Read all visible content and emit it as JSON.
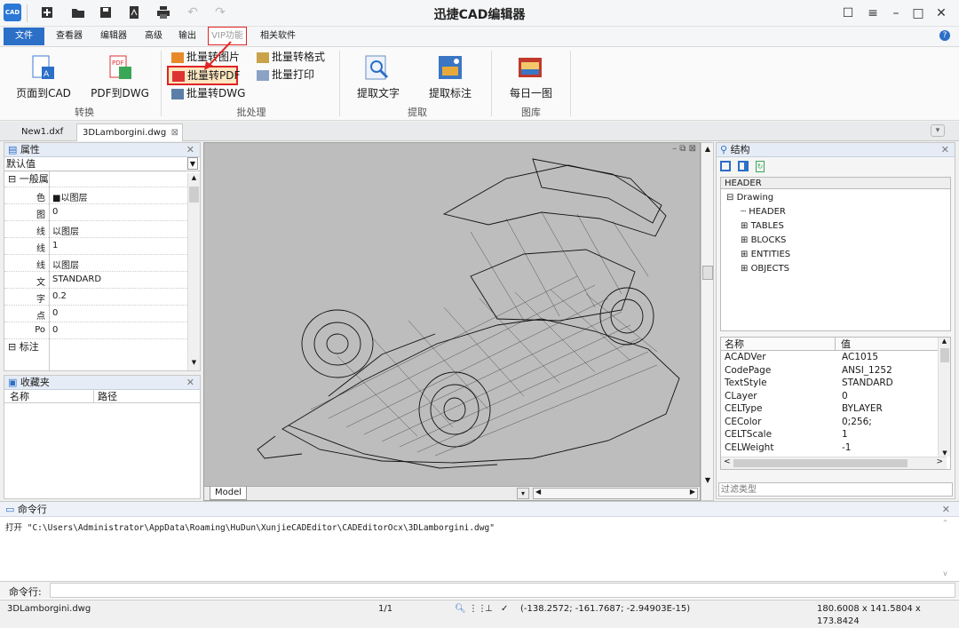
{
  "app": {
    "title": "迅捷CAD编辑器",
    "logo": "CAD"
  },
  "quick_access": {
    "icons": [
      "new-file-icon",
      "open-folder-icon",
      "save-icon",
      "pdf-icon",
      "print-icon",
      "undo-icon",
      "redo-icon"
    ]
  },
  "window_controls": {
    "icons": [
      "feedback-icon",
      "menu-icon",
      "minimize-icon",
      "close-icon"
    ]
  },
  "menu_tabs": [
    "文件",
    "查看器",
    "编辑器",
    "高级",
    "输出",
    "VIP功能",
    "相关软件"
  ],
  "ribbon": {
    "convert": {
      "page_to_cad": "页面到CAD",
      "pdf_to_dwg": "PDF到DWG",
      "group": "转换"
    },
    "batch": {
      "to_image": "批量转图片",
      "to_format": "批量转格式",
      "to_pdf": "批量转PDF",
      "print": "批量打印",
      "to_dwg": "批量转DWG",
      "group": "批处理"
    },
    "extract": {
      "text": "提取文字",
      "annotation": "提取标注",
      "group": "提取"
    },
    "gallery": {
      "daily": "每日一图",
      "group": "图库"
    }
  },
  "doc_tabs": [
    "New1.dxf",
    "3DLamborgini.dwg"
  ],
  "properties": {
    "title": "属性",
    "dropdown": "默认值",
    "section": "一般属",
    "rows": [
      {
        "k": "色",
        "v": "■以图层"
      },
      {
        "k": "图",
        "v": "0"
      },
      {
        "k": "线",
        "v": "以图层"
      },
      {
        "k": "线",
        "v": "1"
      },
      {
        "k": "线",
        "v": "以图层"
      },
      {
        "k": "文",
        "v": "STANDARD"
      },
      {
        "k": "字",
        "v": "0.2"
      },
      {
        "k": "点",
        "v": "0"
      },
      {
        "k": "Po",
        "v": "0"
      }
    ],
    "section2": "标注"
  },
  "favorites": {
    "title": "收藏夹",
    "col_name": "名称",
    "col_path": "路径"
  },
  "canvas": {
    "model_tab": "Model"
  },
  "structure": {
    "title": "结构",
    "header_field": "HEADER",
    "tree": {
      "root": "Drawing",
      "items": [
        "HEADER",
        "TABLES",
        "BLOCKS",
        "ENTITIES",
        "OBJECTS"
      ]
    },
    "table": {
      "col_name": "名称",
      "col_value": "值",
      "rows": [
        [
          "ACADVer",
          "AC1015"
        ],
        [
          "CodePage",
          "ANSI_1252"
        ],
        [
          "TextStyle",
          "STANDARD"
        ],
        [
          "CLayer",
          "0"
        ],
        [
          "CELType",
          "BYLAYER"
        ],
        [
          "CEColor",
          "0;256;"
        ],
        [
          "CELTScale",
          "1"
        ],
        [
          "CELWeight",
          "-1"
        ]
      ]
    },
    "filter_placeholder": "过滤类型"
  },
  "command": {
    "title": "命令行",
    "output": "打开 \"C:\\Users\\Administrator\\AppData\\Roaming\\HuDun\\XunjieCADEditor\\CADEditorOcx\\3DLamborgini.dwg\"",
    "prompt": "命令行:"
  },
  "status": {
    "file": "3DLamborgini.dwg",
    "page": "1/1",
    "coords": "(-138.2572; -161.7687; -2.94903E-15)",
    "size": "180.6008 x 141.5804 x 173.8424"
  },
  "colors": {
    "accent": "#2b6fc7",
    "highlight": "#e02424",
    "canvas_bg": "#bdbdbd"
  }
}
